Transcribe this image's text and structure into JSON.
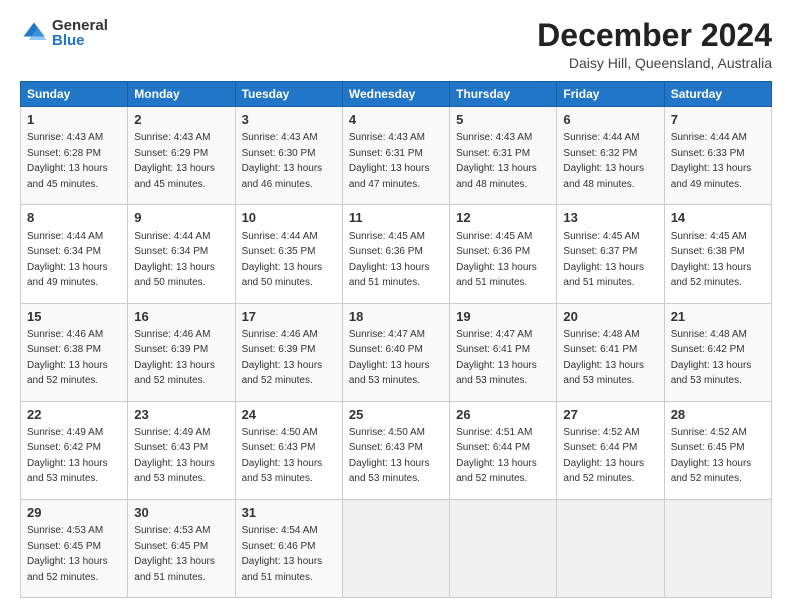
{
  "logo": {
    "general": "General",
    "blue": "Blue"
  },
  "header": {
    "title": "December 2024",
    "subtitle": "Daisy Hill, Queensland, Australia"
  },
  "columns": [
    "Sunday",
    "Monday",
    "Tuesday",
    "Wednesday",
    "Thursday",
    "Friday",
    "Saturday"
  ],
  "weeks": [
    [
      {
        "day": "1",
        "sunrise": "4:43 AM",
        "sunset": "6:28 PM",
        "daylight": "13 hours and 45 minutes."
      },
      {
        "day": "2",
        "sunrise": "4:43 AM",
        "sunset": "6:29 PM",
        "daylight": "13 hours and 45 minutes."
      },
      {
        "day": "3",
        "sunrise": "4:43 AM",
        "sunset": "6:30 PM",
        "daylight": "13 hours and 46 minutes."
      },
      {
        "day": "4",
        "sunrise": "4:43 AM",
        "sunset": "6:31 PM",
        "daylight": "13 hours and 47 minutes."
      },
      {
        "day": "5",
        "sunrise": "4:43 AM",
        "sunset": "6:31 PM",
        "daylight": "13 hours and 48 minutes."
      },
      {
        "day": "6",
        "sunrise": "4:44 AM",
        "sunset": "6:32 PM",
        "daylight": "13 hours and 48 minutes."
      },
      {
        "day": "7",
        "sunrise": "4:44 AM",
        "sunset": "6:33 PM",
        "daylight": "13 hours and 49 minutes."
      }
    ],
    [
      {
        "day": "8",
        "sunrise": "4:44 AM",
        "sunset": "6:34 PM",
        "daylight": "13 hours and 49 minutes."
      },
      {
        "day": "9",
        "sunrise": "4:44 AM",
        "sunset": "6:34 PM",
        "daylight": "13 hours and 50 minutes."
      },
      {
        "day": "10",
        "sunrise": "4:44 AM",
        "sunset": "6:35 PM",
        "daylight": "13 hours and 50 minutes."
      },
      {
        "day": "11",
        "sunrise": "4:45 AM",
        "sunset": "6:36 PM",
        "daylight": "13 hours and 51 minutes."
      },
      {
        "day": "12",
        "sunrise": "4:45 AM",
        "sunset": "6:36 PM",
        "daylight": "13 hours and 51 minutes."
      },
      {
        "day": "13",
        "sunrise": "4:45 AM",
        "sunset": "6:37 PM",
        "daylight": "13 hours and 51 minutes."
      },
      {
        "day": "14",
        "sunrise": "4:45 AM",
        "sunset": "6:38 PM",
        "daylight": "13 hours and 52 minutes."
      }
    ],
    [
      {
        "day": "15",
        "sunrise": "4:46 AM",
        "sunset": "6:38 PM",
        "daylight": "13 hours and 52 minutes."
      },
      {
        "day": "16",
        "sunrise": "4:46 AM",
        "sunset": "6:39 PM",
        "daylight": "13 hours and 52 minutes."
      },
      {
        "day": "17",
        "sunrise": "4:46 AM",
        "sunset": "6:39 PM",
        "daylight": "13 hours and 52 minutes."
      },
      {
        "day": "18",
        "sunrise": "4:47 AM",
        "sunset": "6:40 PM",
        "daylight": "13 hours and 53 minutes."
      },
      {
        "day": "19",
        "sunrise": "4:47 AM",
        "sunset": "6:41 PM",
        "daylight": "13 hours and 53 minutes."
      },
      {
        "day": "20",
        "sunrise": "4:48 AM",
        "sunset": "6:41 PM",
        "daylight": "13 hours and 53 minutes."
      },
      {
        "day": "21",
        "sunrise": "4:48 AM",
        "sunset": "6:42 PM",
        "daylight": "13 hours and 53 minutes."
      }
    ],
    [
      {
        "day": "22",
        "sunrise": "4:49 AM",
        "sunset": "6:42 PM",
        "daylight": "13 hours and 53 minutes."
      },
      {
        "day": "23",
        "sunrise": "4:49 AM",
        "sunset": "6:43 PM",
        "daylight": "13 hours and 53 minutes."
      },
      {
        "day": "24",
        "sunrise": "4:50 AM",
        "sunset": "6:43 PM",
        "daylight": "13 hours and 53 minutes."
      },
      {
        "day": "25",
        "sunrise": "4:50 AM",
        "sunset": "6:43 PM",
        "daylight": "13 hours and 53 minutes."
      },
      {
        "day": "26",
        "sunrise": "4:51 AM",
        "sunset": "6:44 PM",
        "daylight": "13 hours and 52 minutes."
      },
      {
        "day": "27",
        "sunrise": "4:52 AM",
        "sunset": "6:44 PM",
        "daylight": "13 hours and 52 minutes."
      },
      {
        "day": "28",
        "sunrise": "4:52 AM",
        "sunset": "6:45 PM",
        "daylight": "13 hours and 52 minutes."
      }
    ],
    [
      {
        "day": "29",
        "sunrise": "4:53 AM",
        "sunset": "6:45 PM",
        "daylight": "13 hours and 52 minutes."
      },
      {
        "day": "30",
        "sunrise": "4:53 AM",
        "sunset": "6:45 PM",
        "daylight": "13 hours and 51 minutes."
      },
      {
        "day": "31",
        "sunrise": "4:54 AM",
        "sunset": "6:46 PM",
        "daylight": "13 hours and 51 minutes."
      },
      null,
      null,
      null,
      null
    ]
  ]
}
